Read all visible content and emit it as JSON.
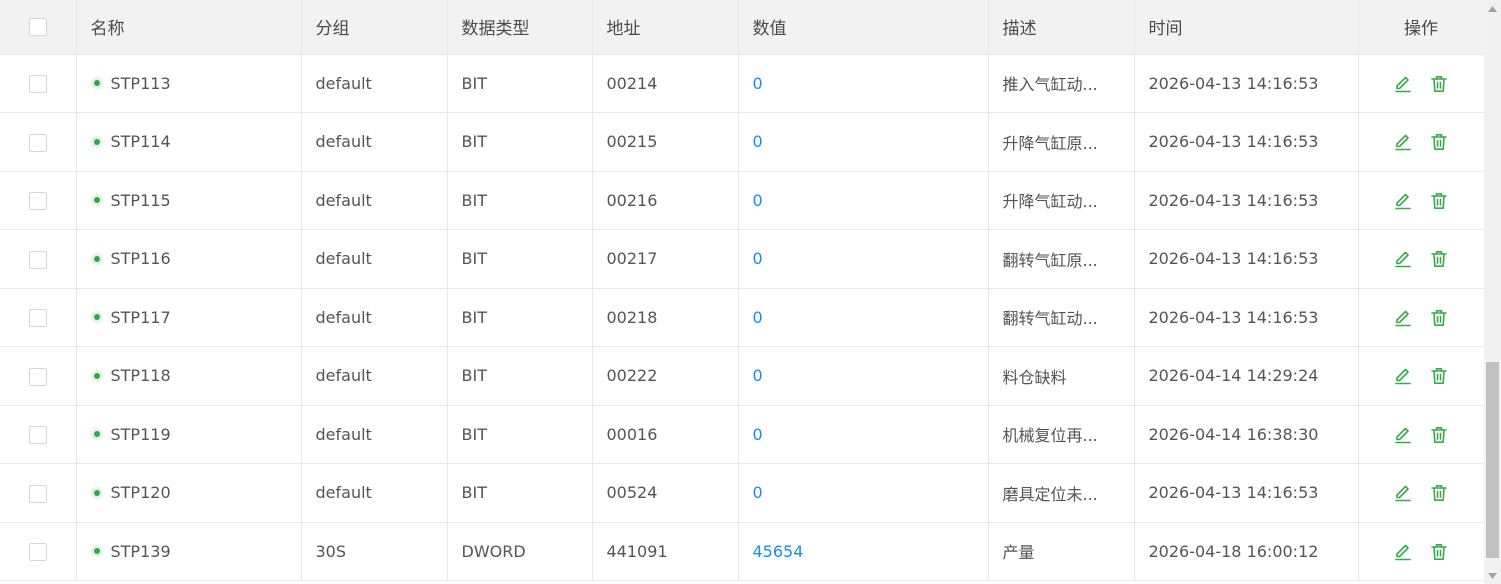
{
  "table": {
    "headers": {
      "name": "名称",
      "group": "分组",
      "datatype": "数据类型",
      "address": "地址",
      "value": "数值",
      "description": "描述",
      "time": "时间",
      "actions": "操作"
    },
    "rows": [
      {
        "name": "STP113",
        "group": "default",
        "datatype": "BIT",
        "address": "00214",
        "value": "0",
        "description": "推入气缸动...",
        "time": "2026-04-13 14:16:53"
      },
      {
        "name": "STP114",
        "group": "default",
        "datatype": "BIT",
        "address": "00215",
        "value": "0",
        "description": "升降气缸原...",
        "time": "2026-04-13 14:16:53"
      },
      {
        "name": "STP115",
        "group": "default",
        "datatype": "BIT",
        "address": "00216",
        "value": "0",
        "description": "升降气缸动...",
        "time": "2026-04-13 14:16:53"
      },
      {
        "name": "STP116",
        "group": "default",
        "datatype": "BIT",
        "address": "00217",
        "value": "0",
        "description": "翻转气缸原...",
        "time": "2026-04-13 14:16:53"
      },
      {
        "name": "STP117",
        "group": "default",
        "datatype": "BIT",
        "address": "00218",
        "value": "0",
        "description": "翻转气缸动...",
        "time": "2026-04-13 14:16:53"
      },
      {
        "name": "STP118",
        "group": "default",
        "datatype": "BIT",
        "address": "00222",
        "value": "0",
        "description": "料仓缺料",
        "time": "2026-04-14 14:29:24"
      },
      {
        "name": "STP119",
        "group": "default",
        "datatype": "BIT",
        "address": "00016",
        "value": "0",
        "description": "机械复位再...",
        "time": "2026-04-14 16:38:30"
      },
      {
        "name": "STP120",
        "group": "default",
        "datatype": "BIT",
        "address": "00524",
        "value": "0",
        "description": "磨具定位未...",
        "time": "2026-04-13 14:16:53"
      },
      {
        "name": "STP139",
        "group": "30S",
        "datatype": "DWORD",
        "address": "441091",
        "value": "45654",
        "description": "产量",
        "time": "2026-04-18 16:00:12"
      }
    ]
  },
  "icons": {
    "status": "status-dot-icon",
    "edit": "edit-icon",
    "delete": "trash-icon"
  },
  "colors": {
    "header_bg": "#f2f2f2",
    "value_link": "#1b8fe0",
    "status_green": "#2dab4a",
    "action_green": "#3aa94d",
    "border": "#e8e8e8"
  }
}
